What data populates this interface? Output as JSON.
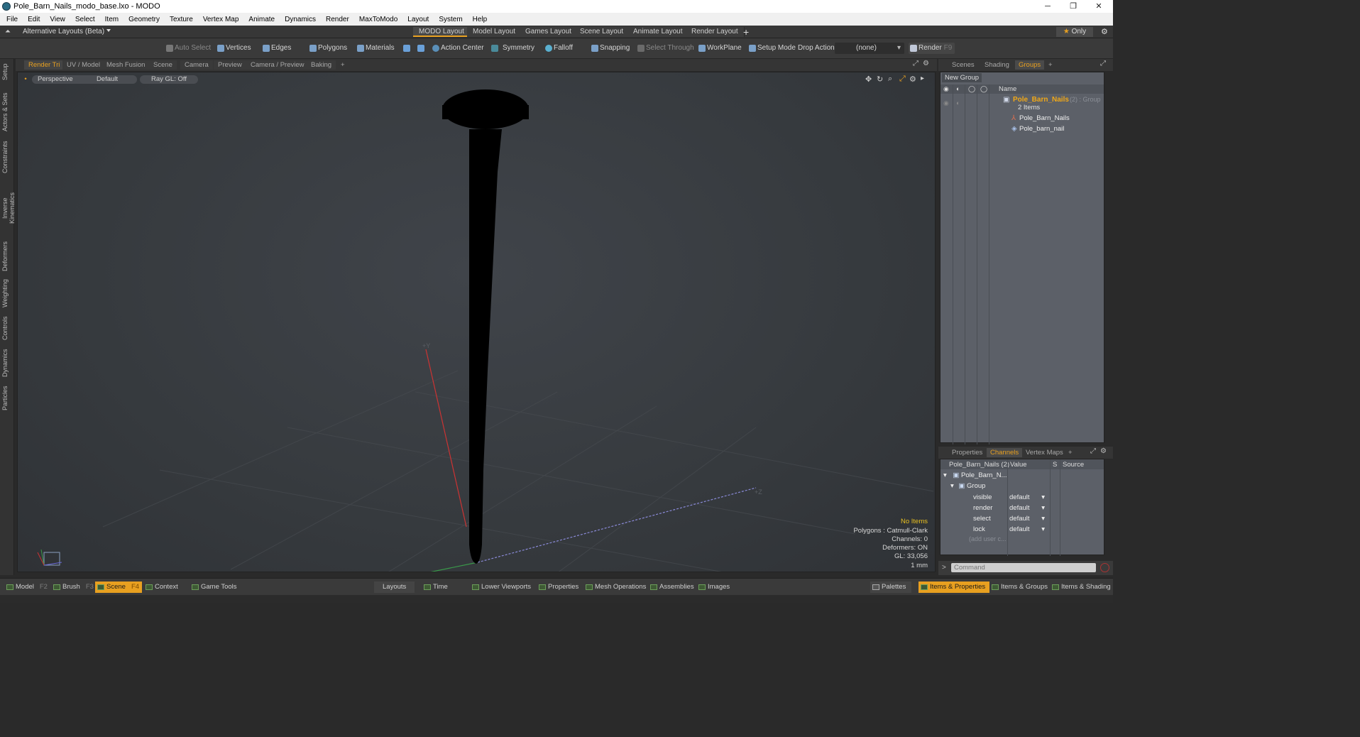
{
  "window": {
    "title": "Pole_Barn_Nails_modo_base.lxo - MODO",
    "controls": [
      "─",
      "❐",
      "✕"
    ]
  },
  "menu": [
    "File",
    "Edit",
    "View",
    "Select",
    "Item",
    "Geometry",
    "Texture",
    "Vertex Map",
    "Animate",
    "Dynamics",
    "Render",
    "MaxToModo",
    "Layout",
    "System",
    "Help"
  ],
  "layout_bar": {
    "alt_layouts": "Alternative Layouts (Beta)",
    "tabs": [
      "MODO Layout",
      "Model Layout",
      "Games Layout",
      "Scene Layout",
      "Animate Layout",
      "Render Layout"
    ],
    "add": "+",
    "only": "Only"
  },
  "toolbar": {
    "auto_select": "Auto Select",
    "vertices": "Vertices",
    "edges": "Edges",
    "polygons": "Polygons",
    "materials": "Materials",
    "action_center": "Action Center",
    "symmetry": "Symmetry",
    "falloff": "Falloff",
    "snapping": "Snapping",
    "select_through": "Select Through",
    "workplane": "WorkPlane",
    "setup_mode": "Setup Mode",
    "drop_action": "Drop Action",
    "none": "(none)",
    "render": "Render",
    "render_key": "F9"
  },
  "left_tabs": [
    "Setup",
    "Actors & Sets",
    "Constraints",
    "Inverse Kinematics",
    "Deformers",
    "Weighting",
    "Controls",
    "Dynamics",
    "Particles"
  ],
  "viewport_tabs": [
    "Render Tri",
    "UV / Model",
    "Mesh Fusion",
    "Scene",
    "Camera",
    "Preview",
    "Camera / Preview",
    "Baking"
  ],
  "viewport": {
    "perspective": "Perspective",
    "default": "Default",
    "raygl": "Ray GL: Off",
    "axis_y": "+Y",
    "axis_z": "+Z",
    "info": {
      "no_items": "No Items",
      "polygons": "Polygons : Catmull-Clark",
      "channels": "Channels: 0",
      "deformers": "Deformers: ON",
      "gl": "GL: 33,056",
      "scale": "1 mm"
    }
  },
  "groups_panel": {
    "tabs": [
      "Scenes",
      "Shading",
      "Groups"
    ],
    "new_group": "New Group",
    "col_name": "Name",
    "group_name": "Pole_Barn_Nails",
    "group_suffix": "(2) : Group",
    "items_count": "2 Items",
    "children": [
      "Pole_Barn_Nails",
      "Pole_barn_nail"
    ]
  },
  "channels_panel": {
    "tabs": [
      "Properties",
      "Channels",
      "Vertex Maps"
    ],
    "header_name": "Pole_Barn_Nails (2)",
    "header_value": "Value",
    "header_s": "S",
    "header_source": "Source",
    "root": "Pole_Barn_N...",
    "group": "Group",
    "rows": [
      {
        "name": "visible",
        "value": "default"
      },
      {
        "name": "render",
        "value": "default"
      },
      {
        "name": "select",
        "value": "default"
      },
      {
        "name": "lock",
        "value": "default"
      }
    ],
    "add_user": "(add user c..."
  },
  "command": {
    "placeholder": "Command"
  },
  "bottom": {
    "model": "Model",
    "model_key": "F2",
    "brush": "Brush",
    "brush_key": "F3",
    "scene": "Scene",
    "scene_key": "F4",
    "context": "Context",
    "game_tools": "Game Tools",
    "layouts": "Layouts",
    "time": "Time",
    "lower_viewports": "Lower Viewports",
    "properties": "Properties",
    "mesh_operations": "Mesh Operations",
    "assemblies": "Assemblies",
    "images": "Images",
    "palettes": "Palettes",
    "items_properties": "Items & Properties",
    "items_groups": "Items & Groups",
    "items_shading": "Items & Shading"
  },
  "colors": {
    "accent": "#e8a020",
    "viewport_bg": "#383c40",
    "nail": "#000000"
  }
}
